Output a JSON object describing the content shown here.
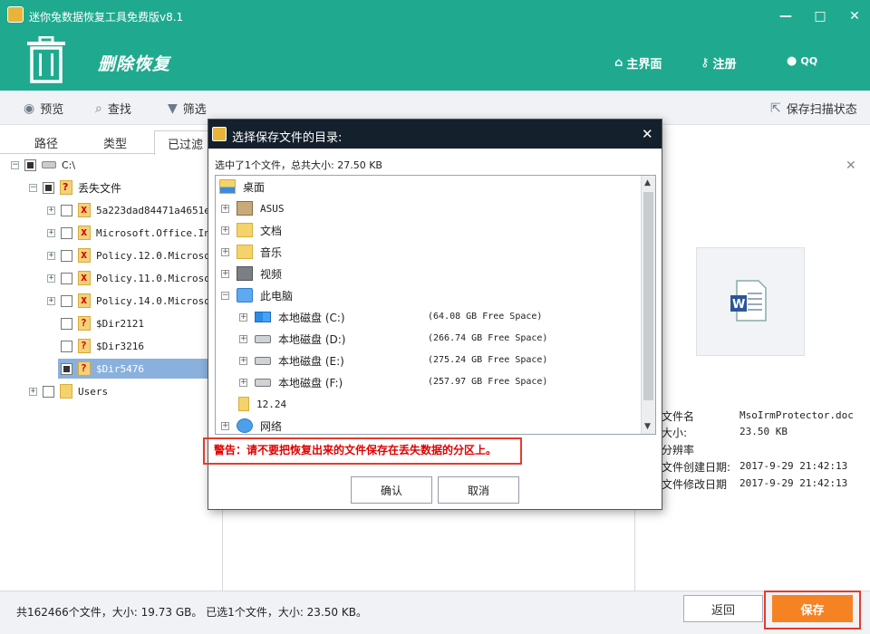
{
  "app": {
    "title": "迷你兔数据恢复工具免费版v8.1",
    "section_title": "删除恢复",
    "nav": {
      "home": "主界面",
      "register": "注册",
      "qq": "QQ"
    }
  },
  "toolbar": {
    "preview": "预览",
    "search": "查找",
    "filter": "筛选",
    "save_scan_state": "保存扫描状态"
  },
  "tabs": [
    "路径",
    "类型",
    "已过滤"
  ],
  "tree": [
    {
      "label": "C:\\",
      "icon": "drive-icon"
    },
    {
      "label": "丢失文件",
      "icon": "lost-file-icon"
    },
    {
      "label": "5a223dad84471a4651ee",
      "icon": "deleted-file-icon"
    },
    {
      "label": "Microsoft.Office.Interop",
      "icon": "deleted-file-icon"
    },
    {
      "label": "Policy.12.0.Microsoft",
      "icon": "deleted-file-icon"
    },
    {
      "label": "Policy.11.0.Microsoft",
      "icon": "deleted-file-icon"
    },
    {
      "label": "Policy.14.0.Microsoft",
      "icon": "deleted-file-icon"
    },
    {
      "label": "$Dir2121",
      "icon": "lost-file-icon"
    },
    {
      "label": "$Dir3216",
      "icon": "lost-file-icon"
    },
    {
      "label": "$Dir5476",
      "icon": "lost-file-icon"
    },
    {
      "label": "Users",
      "icon": "folder-icon"
    }
  ],
  "details": {
    "labels": [
      "文件名",
      "大小:",
      "分辨率",
      "文件创建日期:",
      "文件修改日期"
    ],
    "values": [
      "MsoIrmProtector.doc",
      "23.50 KB",
      "",
      "2017-9-29 21:42:13",
      "2017-9-29 21:42:13"
    ]
  },
  "status": {
    "text": "共162466个文件，大小: 19.73 GB。 已选1个文件，大小: 23.50 KB。",
    "back": "返回",
    "save": "保存"
  },
  "dialog": {
    "title": "选择保存文件的目录:",
    "summary": "选中了1个文件，总共大小: 27.50 KB",
    "items": [
      {
        "label": "桌面",
        "icon": "desktop-icon"
      },
      {
        "label": "ASUS",
        "icon": "user-folder-icon"
      },
      {
        "label": "文档",
        "icon": "documents-folder-icon"
      },
      {
        "label": "音乐",
        "icon": "music-folder-icon"
      },
      {
        "label": "视频",
        "icon": "video-folder-icon"
      },
      {
        "label": "此电脑",
        "icon": "computer-icon"
      },
      {
        "label": "本地磁盘 (C:)",
        "free": "(64.08 GB Free Space)",
        "icon": "windows-drive-icon"
      },
      {
        "label": "本地磁盘 (D:)",
        "free": "(266.74 GB Free Space)",
        "icon": "drive-icon"
      },
      {
        "label": "本地磁盘 (E:)",
        "free": "(275.24 GB Free Space)",
        "icon": "drive-icon"
      },
      {
        "label": "本地磁盘 (F:)",
        "free": "(257.97 GB Free Space)",
        "icon": "drive-icon"
      },
      {
        "label": "12.24",
        "icon": "folder-icon"
      },
      {
        "label": "网络",
        "icon": "network-icon"
      }
    ],
    "warning": "警告：请不要把恢复出来的文件保存在丢失数据的分区上。",
    "ok": "确认",
    "cancel": "取消"
  },
  "colors": {
    "header": "#1faa8f",
    "save": "#f58223",
    "highlight": "#e63a2e",
    "dialog_title": "#14202c"
  }
}
